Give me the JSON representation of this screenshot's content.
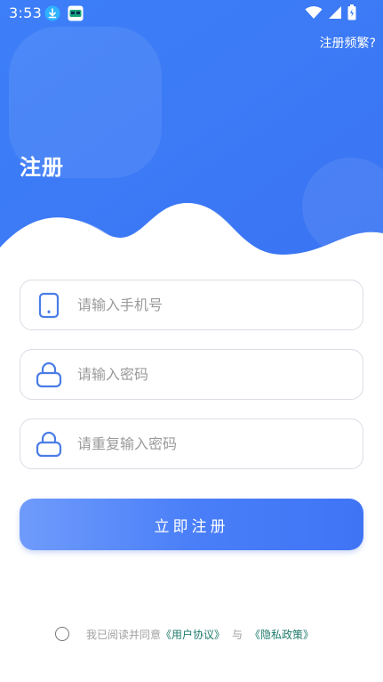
{
  "status_bar": {
    "time": "3:53"
  },
  "header": {
    "help_link": "注册频繁?",
    "title": "注册"
  },
  "form": {
    "phone_placeholder": "请输入手机号",
    "password_placeholder": "请输入密码",
    "confirm_placeholder": "请重复输入密码",
    "submit_label": "立即注册"
  },
  "agreement": {
    "prefix": "我已阅读并同意",
    "user_agreement": "《用户协议》",
    "separator": "与",
    "privacy_policy": "《隐私政策》",
    "checked": false
  },
  "colors": {
    "brand_blue": "#3f7bf7",
    "icon_blue": "#4a7de6",
    "link_green": "#1f7a6c"
  },
  "icons": {
    "status_left": [
      "download-icon",
      "app-notification-icon"
    ],
    "status_right": [
      "wifi-icon",
      "signal-icon",
      "battery-icon"
    ],
    "fields": [
      "phone-icon",
      "lock-icon",
      "lock-icon"
    ]
  }
}
